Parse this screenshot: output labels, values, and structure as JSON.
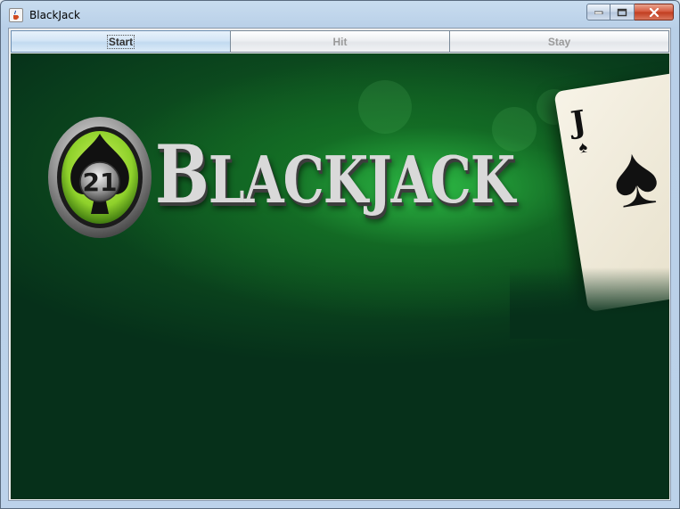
{
  "window": {
    "title": "BlackJack"
  },
  "toolbar": {
    "start_label": "Start",
    "hit_label": "Hit",
    "stay_label": "Stay"
  },
  "banner": {
    "emblem_number": "21",
    "wordmark_initial": "B",
    "wordmark_rest": "LACKJACK",
    "card_rank": "J",
    "card_suit": "♠"
  },
  "colors": {
    "felt": "#06301a",
    "glow": "#2ebe46",
    "emblem_green": "#8fd12b"
  },
  "icons": {
    "app": "java-cup-icon",
    "minimize": "minimize-icon",
    "maximize": "maximize-icon",
    "close": "close-icon"
  }
}
